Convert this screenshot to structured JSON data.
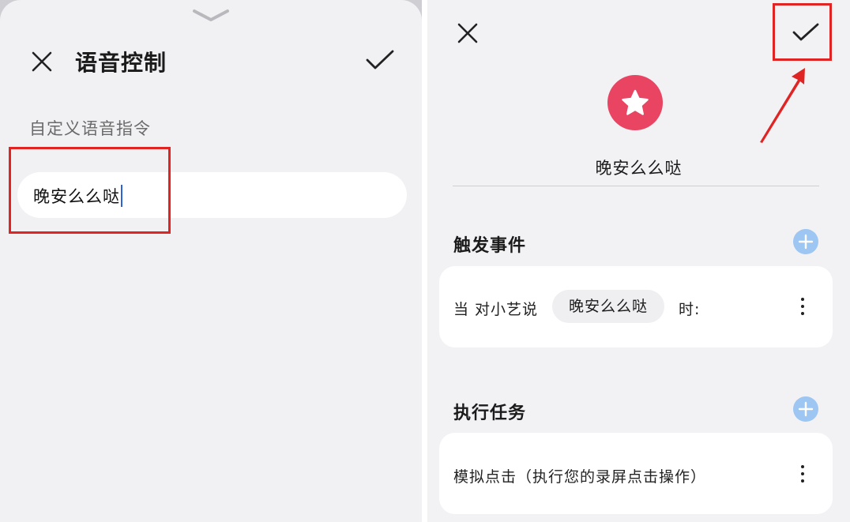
{
  "left": {
    "title": "语音控制",
    "section_label": "自定义语音指令",
    "command_input_value": "晚安么么哒"
  },
  "right": {
    "rule_name": "晚安么么哒",
    "trigger_section_title": "触发事件",
    "trigger": {
      "prefix": "当 对小艺说",
      "phrase": "晚安么么哒",
      "suffix": "时:"
    },
    "task_section_title": "执行任务",
    "task_text": "模拟点击（执行您的录屏点击操作）"
  },
  "icons": {
    "pull_handle": "chevron-down-icon",
    "close": "close-icon",
    "confirm": "check-icon",
    "star": "star-icon",
    "add": "plus-icon",
    "more": "more-vertical-icon",
    "annotation_arrow": "arrow-icon"
  },
  "colors": {
    "highlight_red": "#e02424",
    "star_badge": "#e94462",
    "add_button": "#9ec6f2",
    "caret": "#2a64d8"
  }
}
